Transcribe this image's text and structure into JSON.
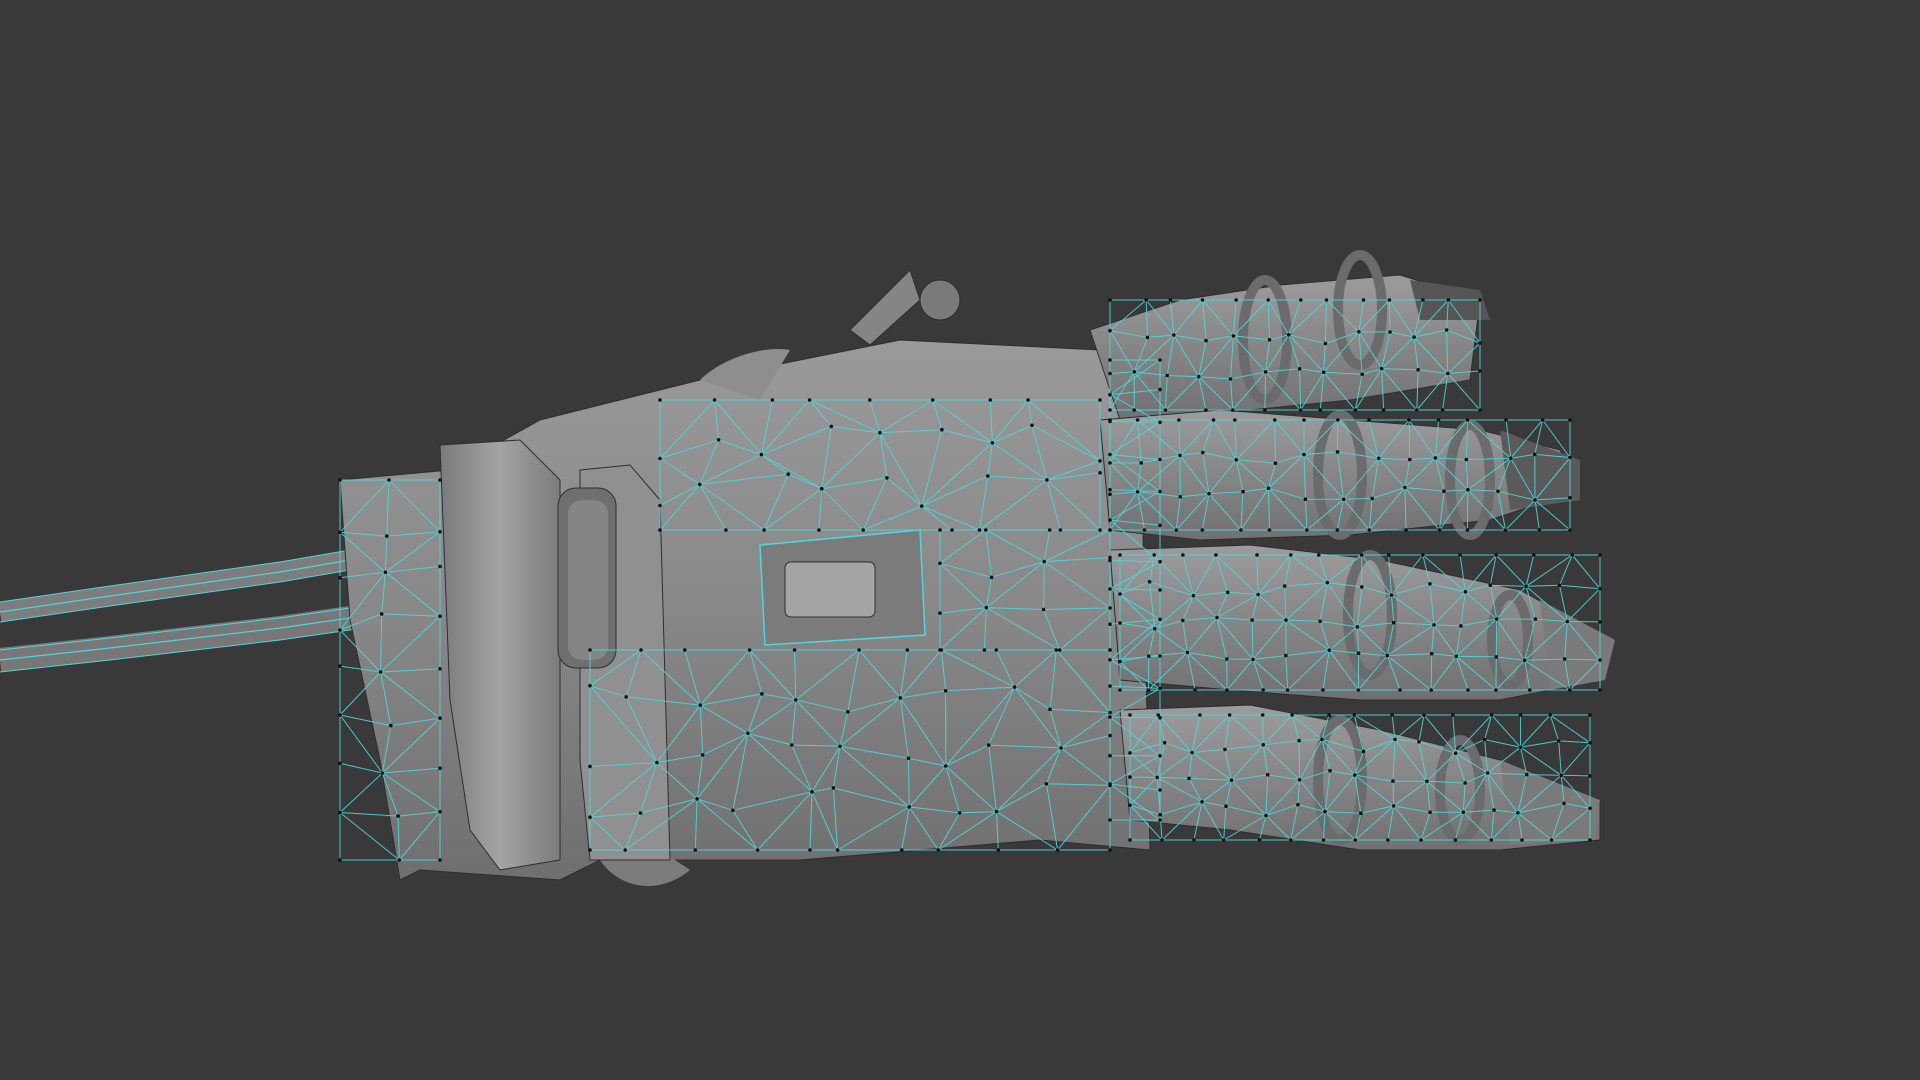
{
  "viewport": {
    "background_color": "#393939",
    "mode": "edit-mode-wireframe-overlay",
    "object": "mechanical-glove-mesh",
    "mesh_color": "#8a8a8a",
    "wire_color": "#4fd6dc",
    "vertex_color": "#111111"
  }
}
